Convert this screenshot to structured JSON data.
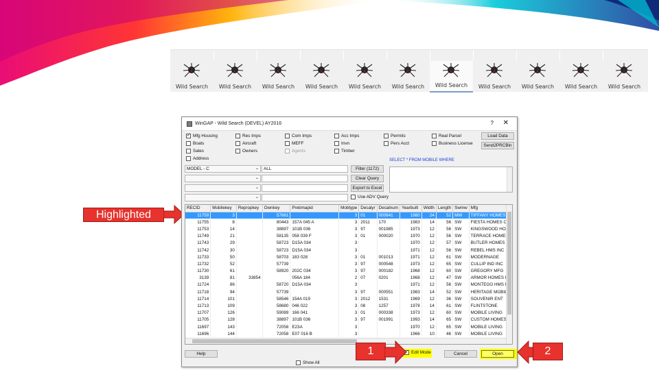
{
  "toolbar": {
    "items": [
      {
        "label": "Wild Search"
      },
      {
        "label": "Wild Search"
      },
      {
        "label": "Wild Search"
      },
      {
        "label": "Wild Search"
      },
      {
        "label": "Wild Search"
      },
      {
        "label": "Wild Search"
      },
      {
        "label": "Wild Search"
      },
      {
        "label": "Wild Search"
      },
      {
        "label": "Wild Search"
      },
      {
        "label": "Wild Search"
      },
      {
        "label": "Wild Search"
      }
    ],
    "active_index": 6
  },
  "window": {
    "title": "WinGAP - Wild Search (DEVEL) AY2016",
    "help_glyph": "?",
    "close_glyph": "✕"
  },
  "checkboxes": {
    "mfg_housing": {
      "label": "Mfg Housing",
      "checked": true
    },
    "boats": {
      "label": "Boats",
      "checked": false
    },
    "sales": {
      "label": "Sales",
      "checked": false
    },
    "address": {
      "label": "Address",
      "checked": false
    },
    "res_imps": {
      "label": "Res Imps",
      "checked": false
    },
    "aircraft": {
      "label": "Aircraft",
      "checked": false
    },
    "owners": {
      "label": "Owners",
      "checked": false
    },
    "com_imps": {
      "label": "Com Imps",
      "checked": false
    },
    "meff": {
      "label": "MEFF",
      "checked": false
    },
    "agents": {
      "label": "Agents",
      "checked": false
    },
    "acc_imps": {
      "label": "Acc Imps",
      "checked": false
    },
    "invn": {
      "label": "Invn",
      "checked": false
    },
    "timber": {
      "label": "Timber",
      "checked": false
    },
    "permits": {
      "label": "Permits",
      "checked": false
    },
    "pers_acct": {
      "label": "Pers Acct",
      "checked": false
    },
    "real_parcel": {
      "label": "Real Parcel",
      "checked": false
    },
    "business_license": {
      "label": "Business License",
      "checked": false
    },
    "use_adv_query": {
      "label": "Use ADV Query",
      "checked": false
    },
    "edit_mode": {
      "label": "Edit Mode",
      "checked": true
    },
    "show_all": {
      "label": "Show All",
      "checked": false
    }
  },
  "buttons": {
    "load_data": "Load Data",
    "send2prcbin": "Send2PRCBin",
    "filter": "Filter (1172)",
    "clear_query": "Clear Query",
    "export_excel": "Export to Excel",
    "help": "Help",
    "cancel": "Cancel",
    "open": "Open"
  },
  "query": {
    "sql_text": "SELECT * FROM MOBILE WHERE",
    "field1": "MODEL - C",
    "value1": "ALL"
  },
  "grid": {
    "columns": [
      "RECID",
      "Mobilekey",
      "Repropkey",
      "Ownkey",
      "Prebmapid",
      "Mobtype",
      "Decalyr",
      "Decalnum",
      "Yearbuilt",
      "Width",
      "Length",
      "Swmw",
      "Mfg"
    ],
    "rows": [
      [
        "11759",
        "3",
        "",
        "57661",
        "",
        "3",
        "01",
        "000641",
        "1980",
        "24",
        "52",
        "MW",
        "TIFFANY HOMES"
      ],
      [
        "11755",
        "8",
        "",
        "80443",
        "157A 045 A",
        "3",
        "2011",
        "170",
        "1983",
        "14",
        "56",
        "SW",
        "FIESTA HOMES OF"
      ],
      [
        "11753",
        "14",
        "",
        "38897",
        "101B 036",
        "3",
        "97",
        "001985",
        "1973",
        "12",
        "56",
        "SW",
        "KINGSWOOD HOM"
      ],
      [
        "11749",
        "21",
        "",
        "58135",
        "058 039 F",
        "3",
        "01",
        "000020",
        "1970",
        "12",
        "56",
        "SW",
        "TERRACE HOMES"
      ],
      [
        "11743",
        "29",
        "",
        "58723",
        "D15A 034",
        "3",
        "",
        "",
        "1970",
        "12",
        "57",
        "SW",
        "BUTLER HOMES"
      ],
      [
        "11742",
        "30",
        "",
        "58723",
        "D15A 034",
        "3",
        "",
        "",
        "1971",
        "12",
        "56",
        "SW",
        "REBEL HMS INC"
      ],
      [
        "11733",
        "50",
        "",
        "58703",
        "183 028",
        "3",
        "01",
        "001013",
        "1971",
        "12",
        "61",
        "SW",
        "MODERNAGE"
      ],
      [
        "11732",
        "52",
        "",
        "57739",
        "",
        "3",
        "97",
        "000548",
        "1973",
        "12",
        "65",
        "SW",
        "CULLIP IND INC"
      ],
      [
        "11730",
        "61",
        "",
        "58920",
        "202C 034",
        "3",
        "97",
        "000182",
        "1968",
        "12",
        "60",
        "SW",
        "GREGORY MFG"
      ],
      [
        "3139",
        "81",
        "33854",
        "",
        "056A 184",
        "2",
        "07",
        "0201",
        "1968",
        "12",
        "47",
        "SW",
        "ARMOR HOMES IN"
      ],
      [
        "11724",
        "86",
        "",
        "58720",
        "D15A 034",
        "3",
        "",
        "",
        "1971",
        "12",
        "56",
        "SW",
        "MONTEGO HMS IN"
      ],
      [
        "11718",
        "94",
        "",
        "57739",
        "",
        "3",
        "97",
        "000551",
        "1983",
        "14",
        "52",
        "SW",
        "HERITAGE MOBILE"
      ],
      [
        "11714",
        "101",
        "",
        "58546",
        "154A 019",
        "3",
        "2012",
        "1531",
        "1969",
        "12",
        "36",
        "SW",
        "SOUVENIR ENT"
      ],
      [
        "11713",
        "109",
        "",
        "58680",
        "046 022",
        "3",
        "08",
        "1257",
        "1978",
        "14",
        "61",
        "SW",
        "FLINTSTONE"
      ],
      [
        "11707",
        "126",
        "",
        "59089",
        "166 041",
        "3",
        "01",
        "000338",
        "1973",
        "12",
        "60",
        "SW",
        "MOBILE LIVING"
      ],
      [
        "11705",
        "128",
        "",
        "38897",
        "101B 036",
        "3",
        "97",
        "001991",
        "1993",
        "14",
        "65",
        "SW",
        "CUSTOM HOMES"
      ],
      [
        "11697",
        "143",
        "",
        "72058",
        "E23A",
        "3",
        "",
        "",
        "1970",
        "12",
        "65",
        "SW",
        "MOBILE LIVING"
      ],
      [
        "11696",
        "144",
        "",
        "72058",
        "E07 016 B",
        "3",
        "",
        "",
        "1966",
        "10",
        "46",
        "SW",
        "MOBILE LIVING"
      ]
    ],
    "selected_row": 0
  },
  "annotations": {
    "highlighted_label": "Highlighted",
    "callout_1": "1",
    "callout_2": "2",
    "callout_color": "#e8322d",
    "highlight_color": "#ffff00"
  }
}
